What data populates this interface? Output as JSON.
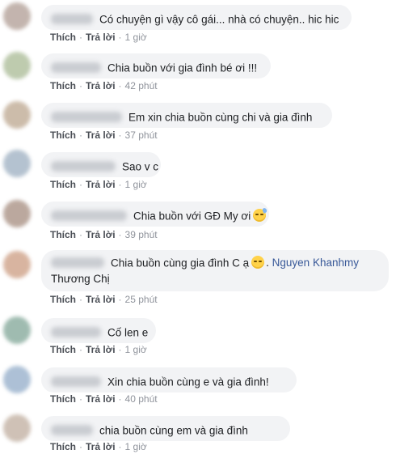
{
  "colors": {
    "bubble_bg": "#f2f3f5",
    "link": "#385898",
    "meta": "#90949c"
  },
  "comments": [
    {
      "text": "Có chuyện gì vậy cô gái... nhà có chuyện.. hic hic",
      "like": "Thích",
      "reply": "Trả lời",
      "time": "1 giờ",
      "avatar_color": "#b9a8a0"
    },
    {
      "text": "Chia buồn với gia đình bé ơi !!!",
      "like": "Thích",
      "reply": "Trả lời",
      "time": "42 phút",
      "avatar_color": "#b3c2a1"
    },
    {
      "text": "Em xin chia buồn cùng chi và gia đình",
      "like": "Thích",
      "reply": "Trả lời",
      "time": "37 phút",
      "avatar_color": "#c4b19c"
    },
    {
      "text": "Sao v c",
      "like": "Thích",
      "reply": "Trả lời",
      "time": "1 giờ",
      "avatar_color": "#a8b8c8"
    },
    {
      "text": "Chia buồn với GĐ My ơi",
      "emoji": "sweat-face-icon",
      "like": "Thích",
      "reply": "Trả lời",
      "time": "39 phút",
      "avatar_color": "#b09a8e"
    },
    {
      "text": "Chia buồn cùng gia đình C ạ",
      "emoji": "pensive-face-icon",
      "tag": "Nguyen Khanhmy",
      "text2": "Thương Chị",
      "like": "Thích",
      "reply": "Trả lời",
      "time": "25 phút",
      "avatar_color": "#d2a890"
    },
    {
      "text": "Cố len e",
      "like": "Thích",
      "reply": "Trả lời",
      "time": "1 giờ",
      "avatar_color": "#8fb0a3"
    },
    {
      "text": "Xin chia buồn cùng e và gia đình!",
      "like": "Thích",
      "reply": "Trả lời",
      "time": "40 phút",
      "avatar_color": "#9fb6cf"
    },
    {
      "text": "chia buồn cùng em và gia đình",
      "like": "Thích",
      "reply": "Trả lời",
      "time": "1 giờ",
      "avatar_color": "#c7b7aa"
    }
  ]
}
